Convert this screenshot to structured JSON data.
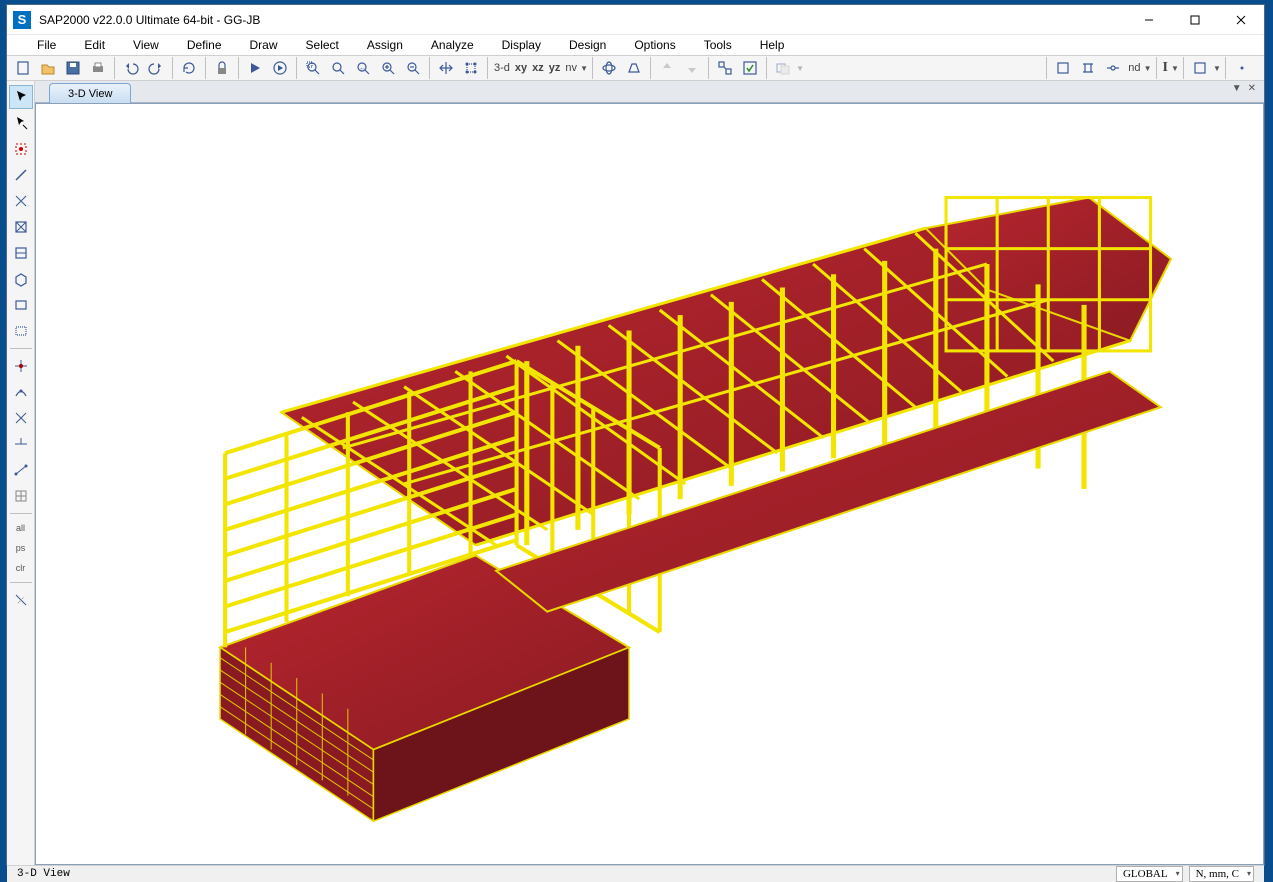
{
  "window": {
    "title": "SAP2000 v22.0.0 Ultimate 64-bit - GG-JB",
    "app_icon_letter": "S"
  },
  "menubar": [
    "File",
    "Edit",
    "View",
    "Define",
    "Draw",
    "Select",
    "Assign",
    "Analyze",
    "Display",
    "Design",
    "Options",
    "Tools",
    "Help"
  ],
  "toolbar": {
    "view_buttons": {
      "3d": "3-d",
      "xy": "xy",
      "xz": "xz",
      "yz": "yz",
      "nv": "nv"
    },
    "right_group_nd": "nd",
    "right_group_I": "I"
  },
  "left_toolbar": {
    "all": "all",
    "ps": "ps",
    "clr": "clr"
  },
  "view": {
    "tab_label": "3-D View"
  },
  "statusbar": {
    "left": "3-D View",
    "coord_system": "GLOBAL",
    "units": "N, mm, C"
  }
}
